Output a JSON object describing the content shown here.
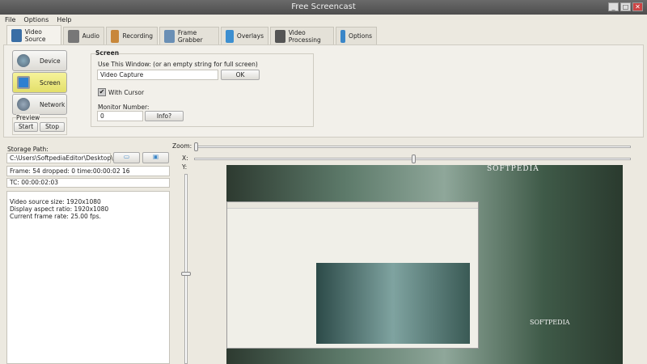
{
  "window": {
    "title": "Free Screencast",
    "minimize": "_",
    "maximize": "□",
    "close": "✕"
  },
  "menu": [
    "File",
    "Options",
    "Help"
  ],
  "tabs": [
    {
      "label": "Video Source",
      "icon": "film-icon",
      "color": "#3a6ea5"
    },
    {
      "label": "Audio",
      "icon": "microphone-icon",
      "color": "#777"
    },
    {
      "label": "Recording",
      "icon": "recording-icon",
      "color": "#c8873a"
    },
    {
      "label": "Frame Grabber",
      "icon": "camera-icon",
      "color": "#6a8fb5"
    },
    {
      "label": "Overlays",
      "icon": "layers-icon",
      "color": "#3d8fd0"
    },
    {
      "label": "Video Processing",
      "icon": "magic-wand-icon",
      "color": "#555"
    },
    {
      "label": "Options",
      "icon": "tools-icon",
      "color": "#3a86c8"
    }
  ],
  "sources": {
    "device": "Device",
    "screen": "Screen",
    "network": "Network",
    "preview_label": "Preview",
    "start": "Start",
    "stop": "Stop"
  },
  "screen": {
    "group": "Screen",
    "window_label": "Use This Window:  (or an empty string for full screen)",
    "window_value": "Video Capture",
    "ok": "OK",
    "with_cursor": "With Cursor",
    "with_cursor_checked": true,
    "monitor_label": "Monitor Number:",
    "monitor_value": "0",
    "info": "Info?"
  },
  "storage": {
    "label": "Storage Path:",
    "path": "C:\\Users\\SoftpediaEditor\\Desktop\\",
    "frame": "Frame: 54 dropped: 0 time:00:00:02 16",
    "tc": "TC: 00:00:02:03",
    "info_lines": [
      "Video source size: 1920x1080",
      "Display aspect ratio: 1920x1080",
      "Current frame rate: 25.00 fps."
    ]
  },
  "sliders": {
    "zoom": "Zoom:",
    "x": "X:",
    "y": "Y:"
  },
  "preview": {
    "watermark": "SOFTPEDIA"
  }
}
